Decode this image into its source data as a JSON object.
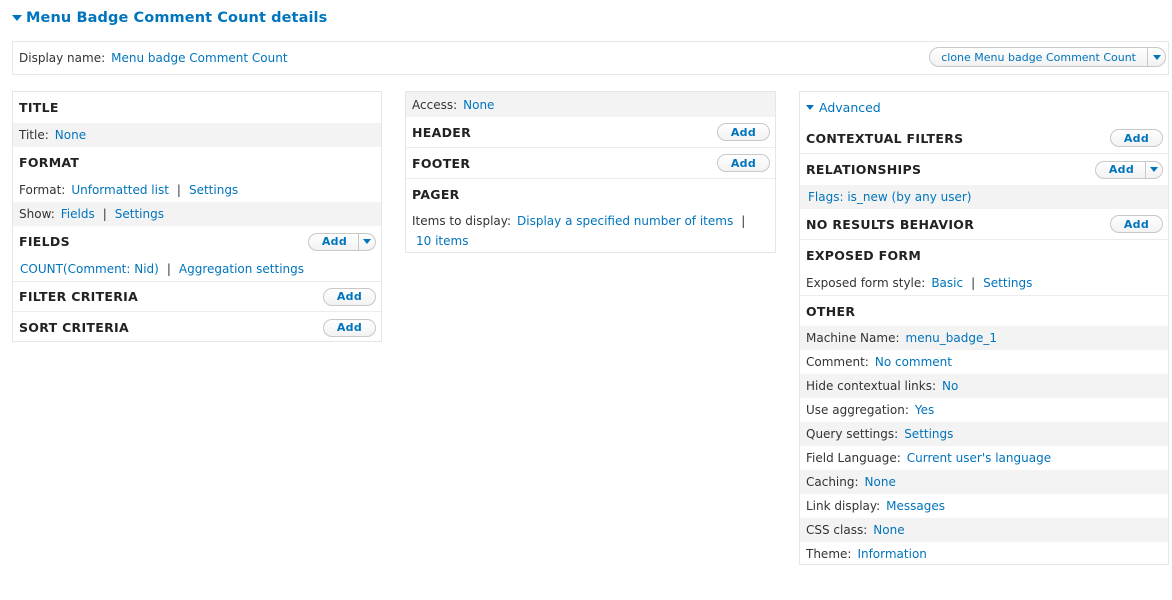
{
  "heading": "Menu Badge Comment Count details",
  "display": {
    "label": "Display name:",
    "value": "Menu badge Comment Count",
    "clone_button": "clone Menu badge Comment Count"
  },
  "left": {
    "title_header": "TITLE",
    "title_label": "Title:",
    "title_value": "None",
    "format_header": "FORMAT",
    "format_label": "Format:",
    "format_value": "Unformatted list",
    "format_settings": "Settings",
    "show_label": "Show:",
    "show_value": "Fields",
    "show_settings": "Settings",
    "fields_header": "FIELDS",
    "fields_add": "Add",
    "field_item": "COUNT(Comment: Nid)",
    "field_aggregation": "Aggregation settings",
    "filter_header": "FILTER CRITERIA",
    "filter_add": "Add",
    "sort_header": "SORT CRITERIA",
    "sort_add": "Add"
  },
  "middle": {
    "access_label": "Access:",
    "access_value": "None",
    "header_header": "HEADER",
    "header_add": "Add",
    "footer_header": "FOOTER",
    "footer_add": "Add",
    "pager_header": "PAGER",
    "pager_label": "Items to display:",
    "pager_value": "Display a specified number of items",
    "pager_count": "10 items"
  },
  "right": {
    "advanced": "Advanced",
    "contextual_header": "CONTEXTUAL FILTERS",
    "contextual_add": "Add",
    "relationships_header": "RELATIONSHIPS",
    "relationships_add": "Add",
    "relationship_item": "Flags: is_new (by any user)",
    "no_results_header": "NO RESULTS BEHAVIOR",
    "no_results_add": "Add",
    "exposed_header": "EXPOSED FORM",
    "exposed_label": "Exposed form style:",
    "exposed_value": "Basic",
    "exposed_settings": "Settings",
    "other_header": "OTHER",
    "other_rows": [
      {
        "label": "Machine Name:",
        "value": "menu_badge_1"
      },
      {
        "label": "Comment:",
        "value": "No comment"
      },
      {
        "label": "Hide contextual links:",
        "value": "No"
      },
      {
        "label": "Use aggregation:",
        "value": "Yes"
      },
      {
        "label": "Query settings:",
        "value": "Settings"
      },
      {
        "label": "Field Language:",
        "value": "Current user's language"
      },
      {
        "label": "Caching:",
        "value": "None"
      },
      {
        "label": "Link display:",
        "value": "Messages"
      },
      {
        "label": "CSS class:",
        "value": "None"
      },
      {
        "label": "Theme:",
        "value": "Information"
      }
    ]
  },
  "colors": {
    "link": "#0074bd",
    "shade": "#f3f3f3",
    "border": "#e6e6e6"
  }
}
